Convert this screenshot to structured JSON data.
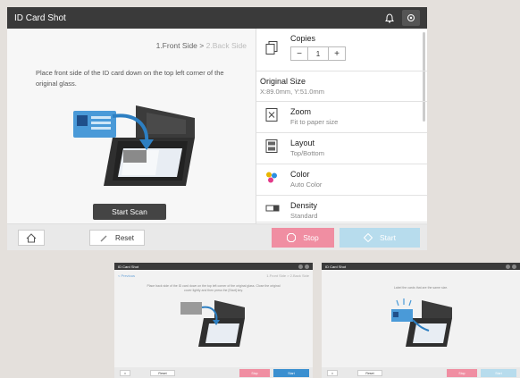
{
  "window": {
    "title": "ID Card Shot"
  },
  "steps": {
    "step1": "1.Front Side",
    "sep": ">",
    "step2": "2.Back Side"
  },
  "instructions": "Place front side of the ID card down on the top left corner of the original glass.",
  "start_scan_label": "Start Scan",
  "settings": {
    "copies": {
      "label": "Copies",
      "value": "1",
      "minus": "−",
      "plus": "+"
    },
    "original_size": {
      "label": "Original Size",
      "value": "X:89.0mm, Y:51.0mm"
    },
    "zoom": {
      "label": "Zoom",
      "value": "Fit to paper size"
    },
    "layout": {
      "label": "Layout",
      "value": "Top/Bottom"
    },
    "color": {
      "label": "Color",
      "value": "Auto Color"
    },
    "density": {
      "label": "Density",
      "value": "Standard"
    }
  },
  "bottom": {
    "reset_label": "Reset",
    "stop_label": "Stop",
    "start_label": "Start"
  },
  "thumbnails": [
    {
      "title": "ID Card Shot",
      "back_label": "< Previous",
      "step_label": "1.Front Side > 2.Back Side",
      "text": "Place back side of the ID card down on the top left corner of the original glass. Close the original cover lightly and then press the [Start] key.",
      "reset_label": "Reset",
      "stop_label": "Stop",
      "start_label": "Start"
    },
    {
      "title": "ID Card Shot",
      "text": "Label the cards that are the same size.",
      "reset_label": "Reset",
      "stop_label": "Stop",
      "start_label": "Start"
    }
  ],
  "colors": {
    "titlebar": "#3a3a3a",
    "stop": "#f08ea2",
    "start_disabled": "#b7dced",
    "start_active": "#3a8fd0",
    "card_blue": "#4a9ad8"
  }
}
